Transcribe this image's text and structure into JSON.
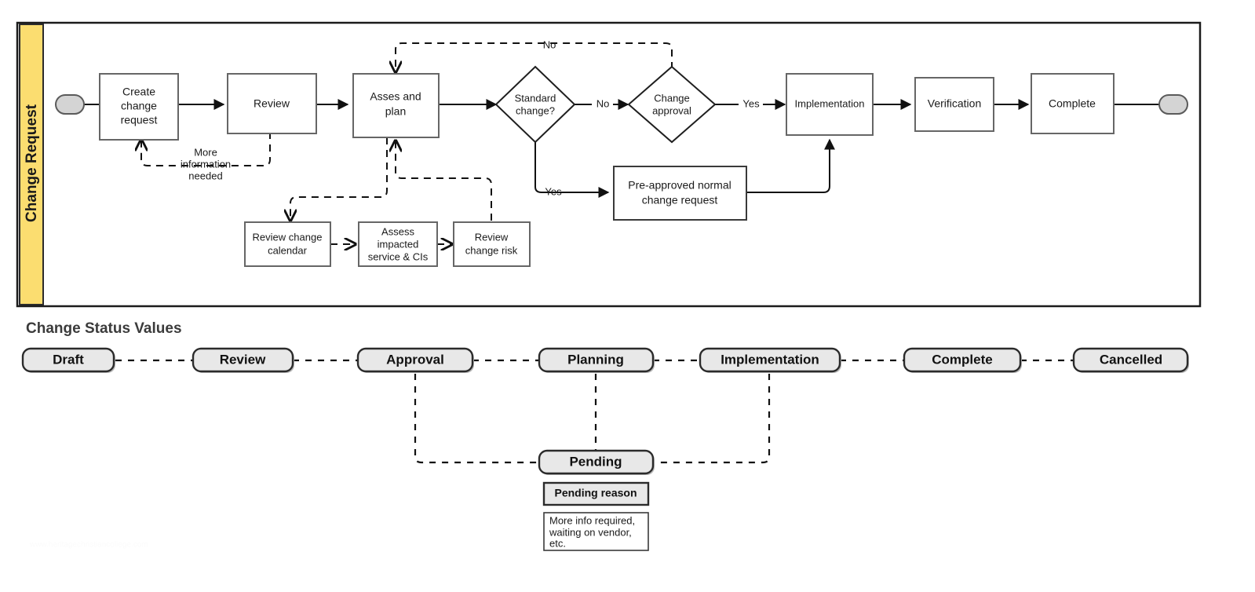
{
  "lane": {
    "label": "Change Request",
    "band_color": "#fbdd70"
  },
  "flow": {
    "start_node": "start-terminator",
    "end_node": "end-terminator",
    "nodes": [
      {
        "id": "create",
        "label": "Create change request",
        "lines": [
          "Create",
          "change",
          "request"
        ],
        "shape": "process"
      },
      {
        "id": "review",
        "label": "Review",
        "lines": [
          "Review"
        ],
        "shape": "process"
      },
      {
        "id": "assess",
        "label": "Asses and plan",
        "lines": [
          "Asses and",
          "plan"
        ],
        "shape": "process"
      },
      {
        "id": "standard",
        "label": "Standard change?",
        "lines": [
          "Standard",
          "change?"
        ],
        "shape": "decision"
      },
      {
        "id": "approval",
        "label": "Change approval",
        "lines": [
          "Change",
          "approval"
        ],
        "shape": "decision"
      },
      {
        "id": "implementation",
        "label": "Implementation",
        "lines": [
          "Implementation"
        ],
        "shape": "process"
      },
      {
        "id": "verification",
        "label": "Verification",
        "lines": [
          "Verification"
        ],
        "shape": "process"
      },
      {
        "id": "complete",
        "label": "Complete",
        "lines": [
          "Complete"
        ],
        "shape": "process"
      },
      {
        "id": "preapproved",
        "label": "Pre-approved normal change request",
        "lines": [
          "Pre-approved normal",
          "change request"
        ],
        "shape": "process"
      },
      {
        "id": "reviewcal",
        "label": "Review change calendar",
        "lines": [
          "Review change",
          "calendar"
        ],
        "shape": "process"
      },
      {
        "id": "assessimpact",
        "label": "Assess impacted service & CIs",
        "lines": [
          "Assess",
          "impacted",
          "service & CIs"
        ],
        "shape": "process"
      },
      {
        "id": "reviewrisk",
        "label": "Review change risk",
        "lines": [
          "Review",
          "change risk"
        ],
        "shape": "process"
      }
    ],
    "edge_labels": {
      "more_info": [
        "More",
        "information",
        "needed"
      ],
      "no_top": "No",
      "standard_no": "No",
      "standard_yes": "Yes",
      "approval_yes": "Yes"
    }
  },
  "status_section": {
    "title": "Change Status Values",
    "pills": [
      {
        "id": "draft",
        "label": "Draft"
      },
      {
        "id": "review",
        "label": "Review"
      },
      {
        "id": "approval",
        "label": "Approval"
      },
      {
        "id": "planning",
        "label": "Planning"
      },
      {
        "id": "implementation",
        "label": "Implementation"
      },
      {
        "id": "complete",
        "label": "Complete"
      },
      {
        "id": "cancelled",
        "label": "Cancelled"
      }
    ],
    "pending": {
      "label": "Pending",
      "reason_label": "Pending reason",
      "reason_examples": [
        "More info required,",
        "waiting on vendor,",
        "etc."
      ]
    }
  },
  "watermark": {
    "text": "www.heritagechristiancollege.com"
  }
}
